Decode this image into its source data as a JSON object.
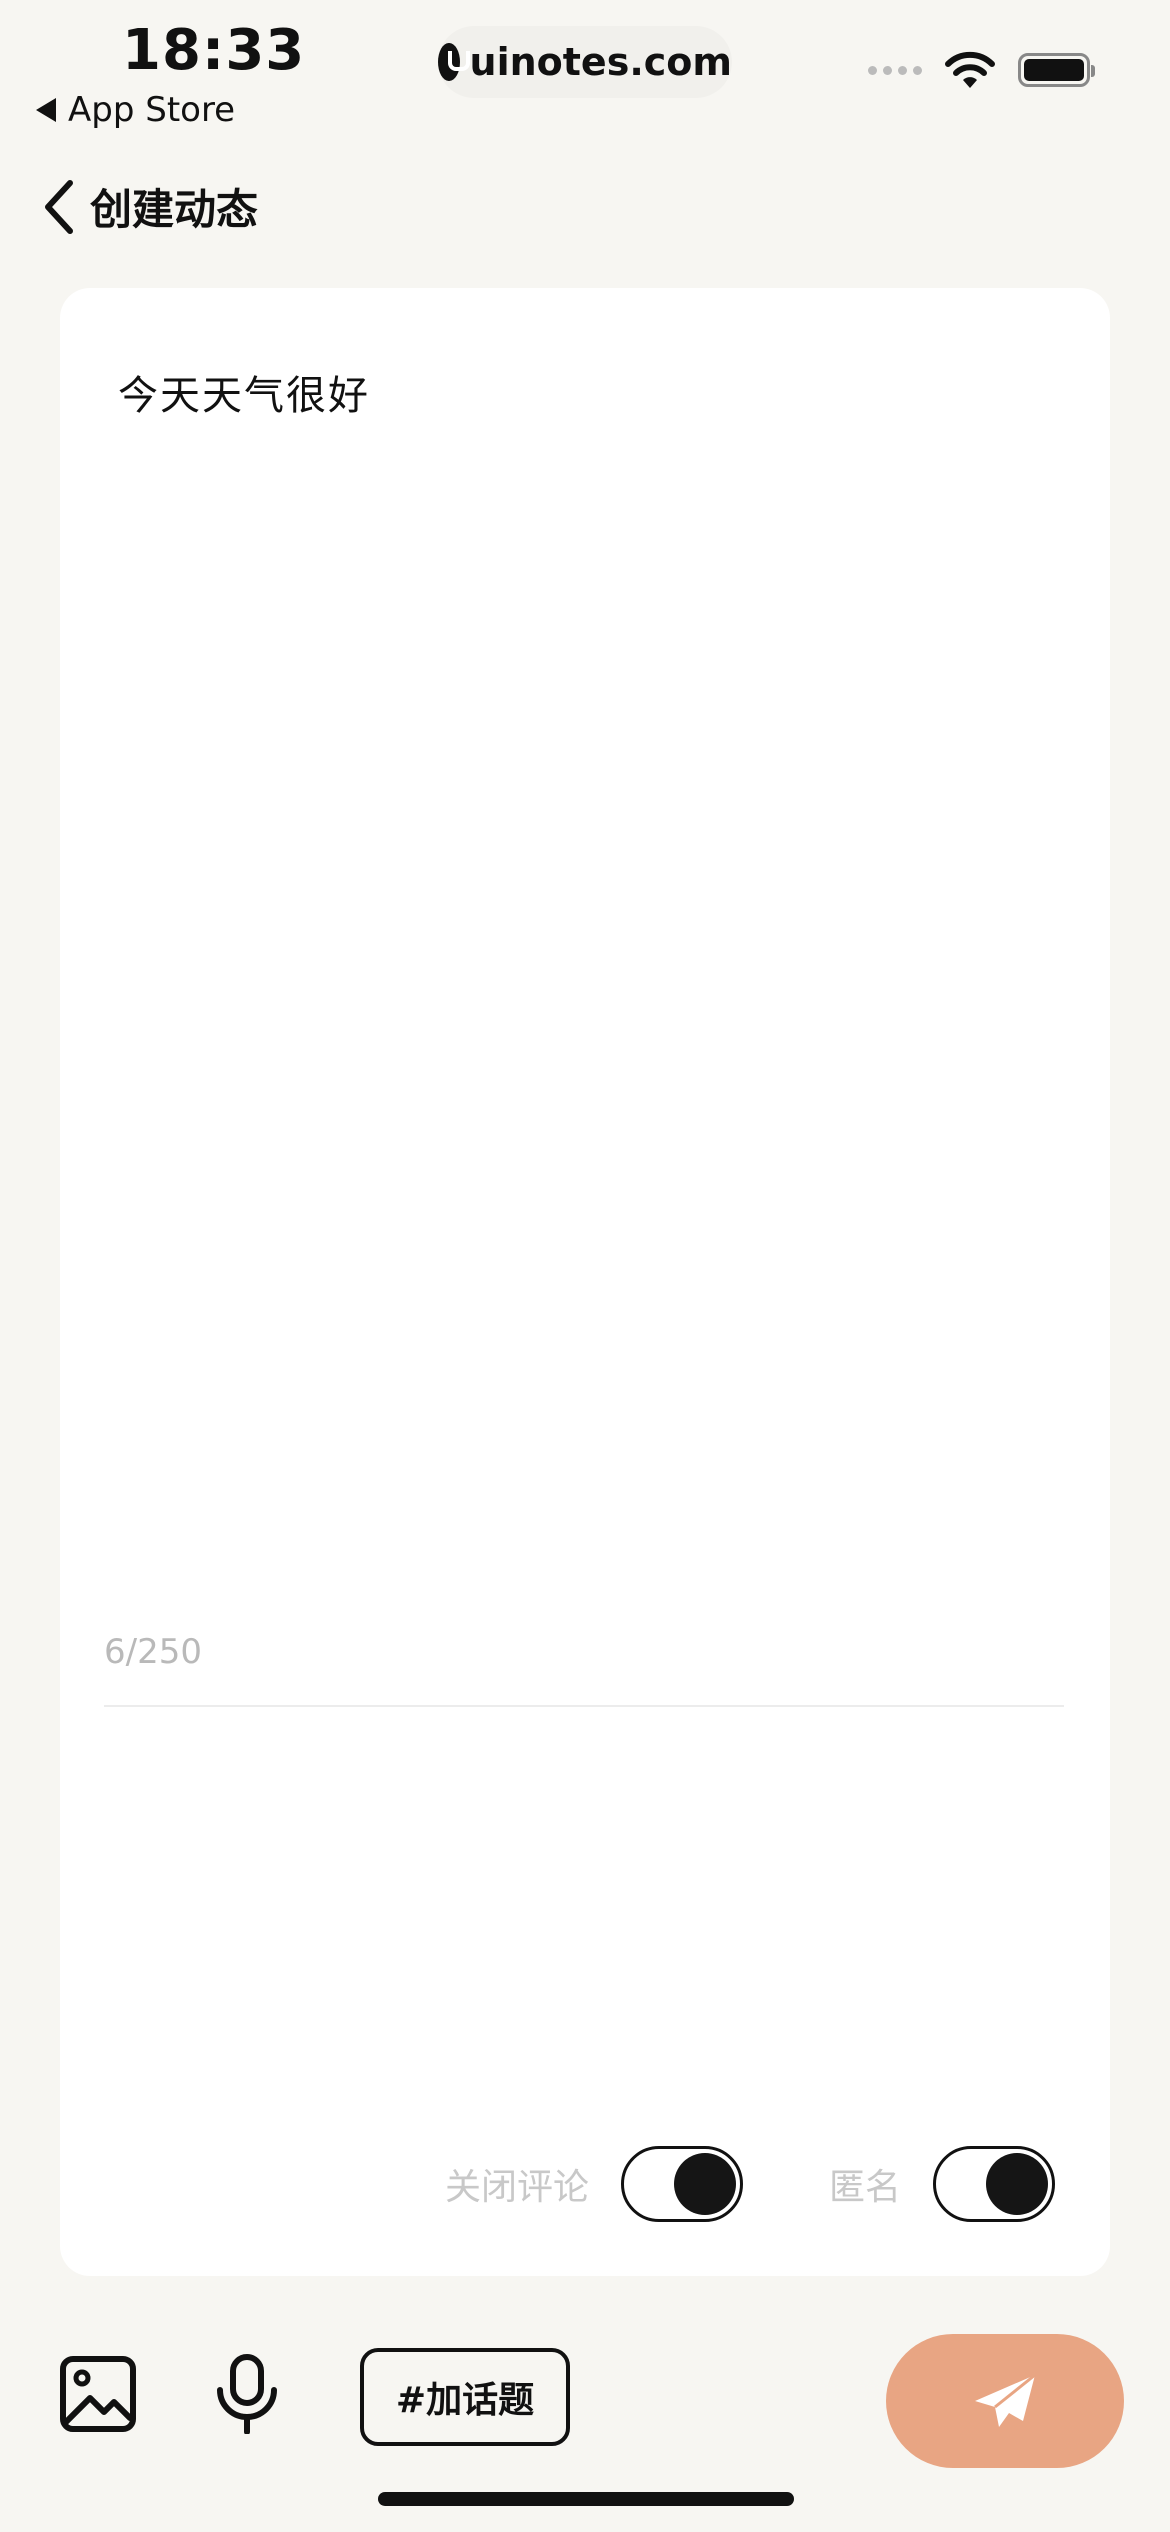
{
  "status_bar": {
    "time": "18:33",
    "back_app": "App Store",
    "url": "uinotes.com"
  },
  "header": {
    "title": "创建动态"
  },
  "post": {
    "text": "今天天气很好",
    "counter": "6/250"
  },
  "toggles": {
    "close_comments": {
      "label": "关闭评论",
      "on": true
    },
    "anonymous": {
      "label": "匿名",
      "on": true
    }
  },
  "toolbar": {
    "topic_label": "#加话题"
  },
  "colors": {
    "background": "#f7f6f2",
    "card": "#ffffff",
    "send_button": "#e8a583",
    "toggle_knob": "#151515"
  },
  "icons": {
    "image": "image-icon",
    "mic": "microphone-icon",
    "send": "paper-plane-icon",
    "back": "chevron-left-icon"
  }
}
